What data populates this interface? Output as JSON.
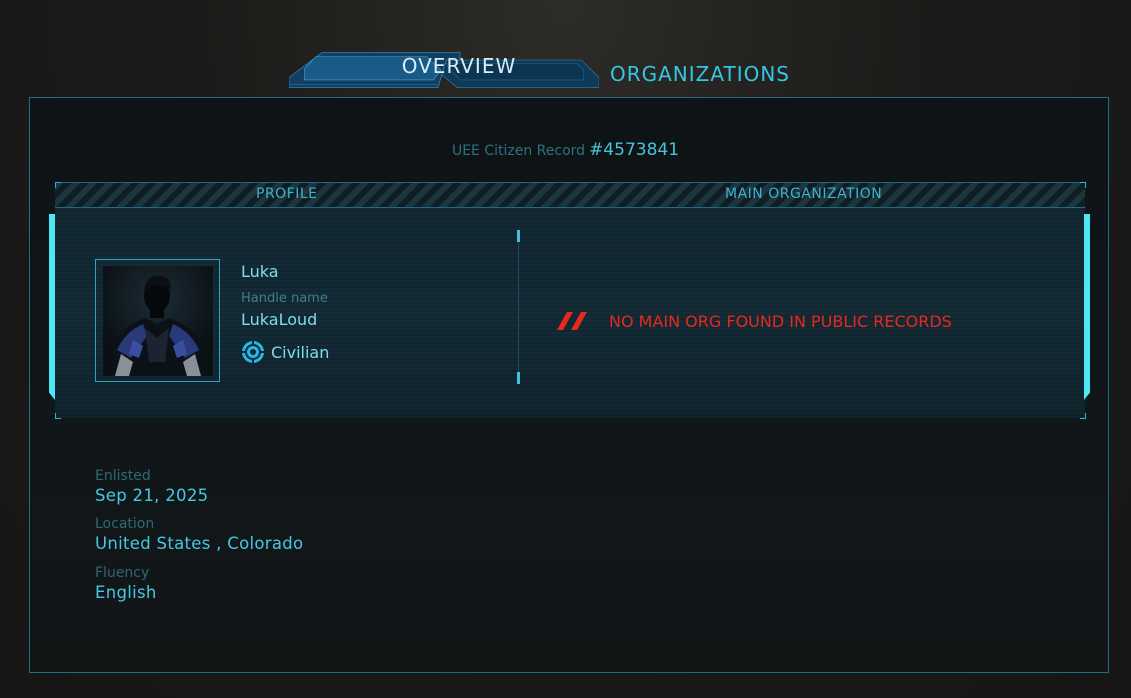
{
  "tabs": {
    "overview_label": "OVERVIEW",
    "organizations_label": "ORGANIZATIONS"
  },
  "record": {
    "label": "UEE Citizen Record",
    "number": "#4573841"
  },
  "panel": {
    "profile_header": "PROFILE",
    "main_org_header": "MAIN ORGANIZATION"
  },
  "profile": {
    "name": "Luka",
    "handle_label": "Handle name",
    "handle": "LukaLoud",
    "rank": "Civilian",
    "rank_icon": "crosshair-icon",
    "avatar_icon": "silhouette-avatar"
  },
  "main_org": {
    "message": "NO MAIN ORG FOUND IN PUBLIC RECORDS",
    "icon": "double-slash-icon"
  },
  "details": {
    "enlisted_label": "Enlisted",
    "enlisted_value": "Sep 21, 2025",
    "location_label": "Location",
    "location_value": "United States , Colorado",
    "fluency_label": "Fluency",
    "fluency_value": "English"
  },
  "colors": {
    "accent": "#35c6e3",
    "warning": "#e8281e",
    "border": "#1d6d84"
  }
}
